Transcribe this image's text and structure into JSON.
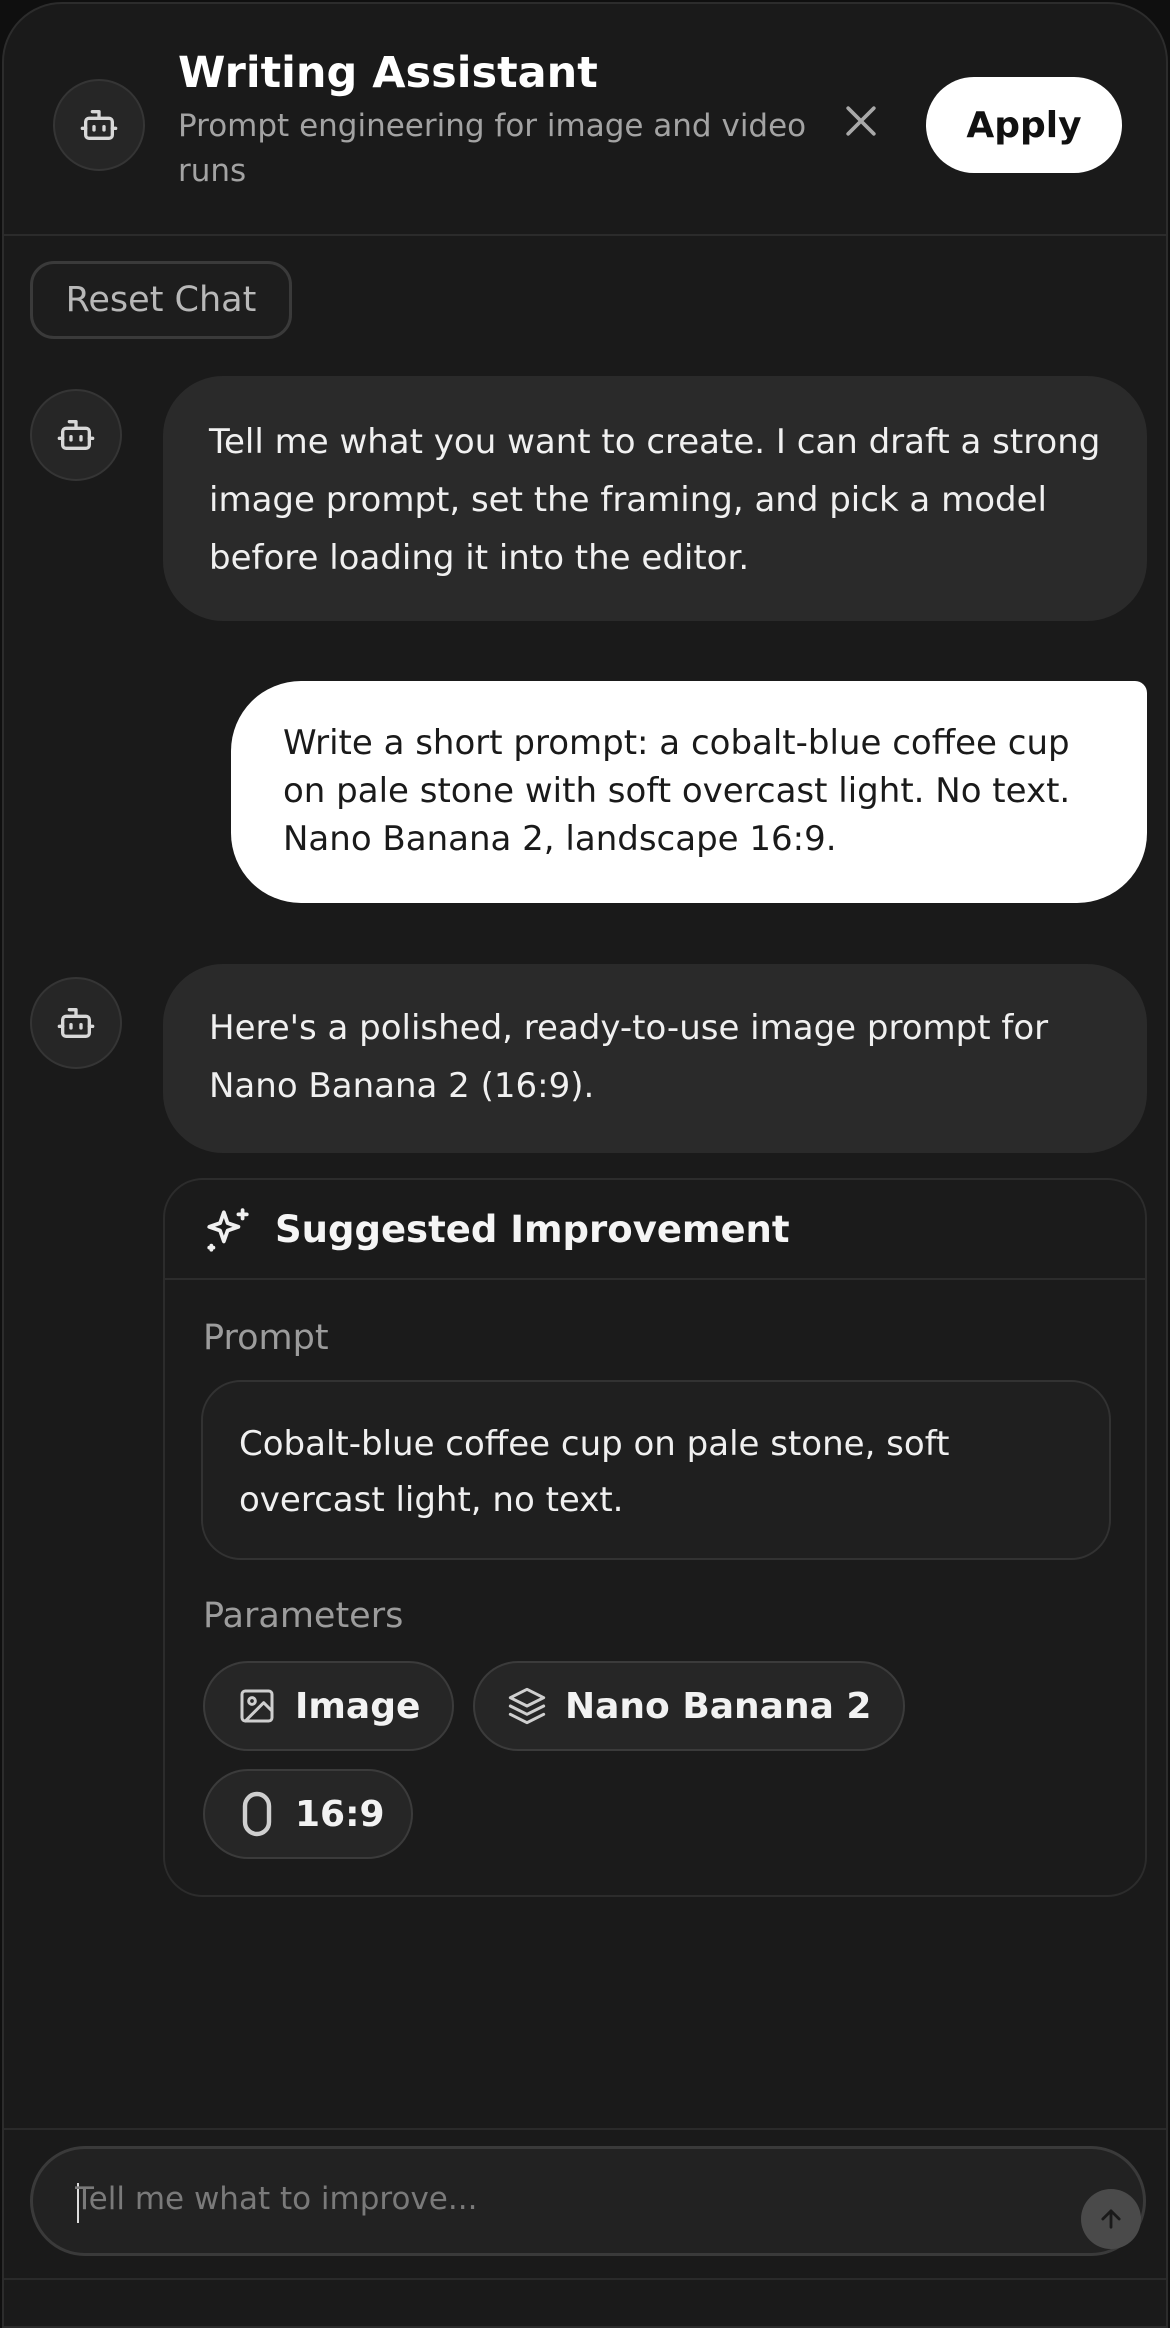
{
  "header": {
    "title": "Writing Assistant",
    "subtitle": "Prompt engineering for image and video runs",
    "apply_label": "Apply",
    "avatar_icon": "bot-icon",
    "close_icon": "close-icon"
  },
  "reset_label": "Reset Chat",
  "messages": [
    {
      "role": "assistant",
      "text": "Tell me what you want to create. I can draft a strong image prompt, set the framing, and pick a model before loading it into the editor."
    },
    {
      "role": "user",
      "text": "Write a short prompt: a cobalt-blue coffee cup on pale stone with soft overcast light. No text. Nano Banana 2, landscape 16:9."
    },
    {
      "role": "assistant",
      "text": "Here's a polished, ready-to-use image prompt for Nano Banana 2 (16:9)."
    }
  ],
  "suggestion": {
    "title": "Suggested Improvement",
    "prompt_label": "Prompt",
    "prompt_text": "Cobalt-blue coffee cup on pale stone, soft overcast light, no text.",
    "params_label": "Parameters",
    "params": [
      {
        "icon": "image-icon",
        "label": "Image"
      },
      {
        "icon": "layers-icon",
        "label": "Nano Banana 2"
      },
      {
        "icon": "aspect-ratio-icon",
        "label": "16:9"
      }
    ]
  },
  "composer": {
    "placeholder": "Tell me what to improve...",
    "send_icon": "arrow-up-icon"
  },
  "colors": {
    "background": "#1a1a1a",
    "assistant_bubble": "#2a2a2a",
    "user_bubble": "#ffffff",
    "apply_button": "#ffffff"
  }
}
